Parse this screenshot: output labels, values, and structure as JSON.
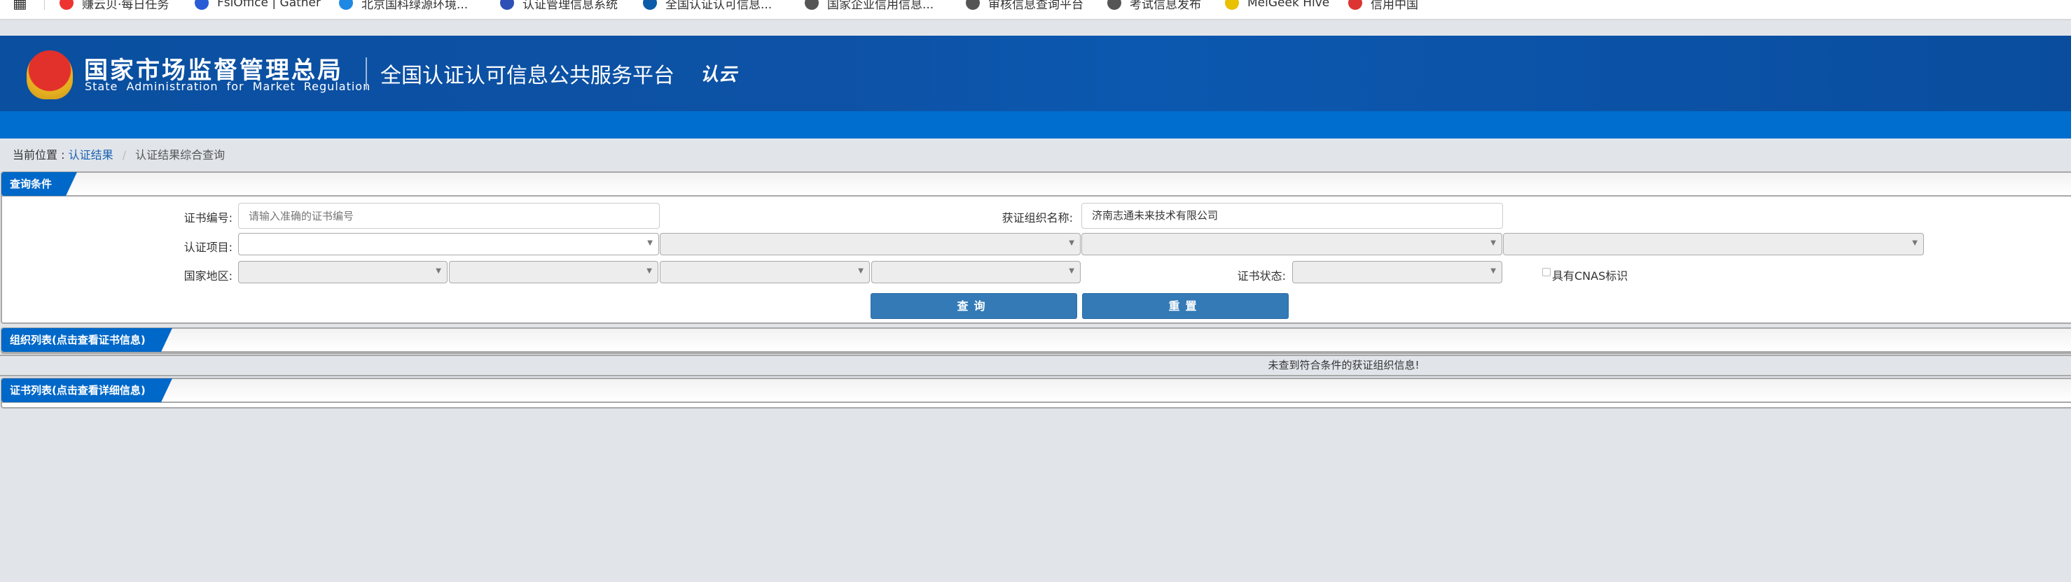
{
  "bookmarks": [
    {
      "label": "赚云贝·每日任务",
      "color": "#e33"
    },
    {
      "label": "FsiOffice | Gather",
      "color": "#2a5bd7"
    },
    {
      "label": "北京国科绿源环境...",
      "color": "#1e88e5"
    },
    {
      "label": "认证管理信息系统",
      "color": "#2e4fb5"
    },
    {
      "label": "全国认证认可信息...",
      "color": "#0b5ca8"
    },
    {
      "label": "国家企业信用信息...",
      "color": "#555"
    },
    {
      "label": "审核信息查询平台",
      "color": "#555"
    },
    {
      "label": "考试信息发布",
      "color": "#555"
    },
    {
      "label": "MelGeek Hive",
      "color": "#e8c100"
    },
    {
      "label": "信用中国",
      "color": "#d33"
    }
  ],
  "header": {
    "org_cn": "国家市场监督管理总局",
    "org_en": "State Administration  for  Market Regulation",
    "platform": "全国认证认可信息公共服务平台",
    "logo": "认云"
  },
  "breadcrumb": {
    "prefix": "当前位置 :",
    "link": "认证结果",
    "sep": "/",
    "current": "认证结果综合查询"
  },
  "query": {
    "title": "查询条件",
    "cert_no_label": "证书编号:",
    "cert_no_placeholder": "请输入准确的证书编号",
    "cert_no_value": "",
    "org_label": "获证组织名称:",
    "org_value": "济南志通未来技术有限公司",
    "project_label": "认证项目:",
    "region_label": "国家地区:",
    "status_label": "证书状态:",
    "cnas_label": "具有CNAS标识",
    "search_btn": "查询",
    "reset_btn": "重置"
  },
  "org_list": {
    "title": "组织列表(点击查看证书信息)",
    "empty_msg": "未查到符合条件的获证组织信息!"
  },
  "cert_list": {
    "title": "证书列表(点击查看详细信息)"
  }
}
